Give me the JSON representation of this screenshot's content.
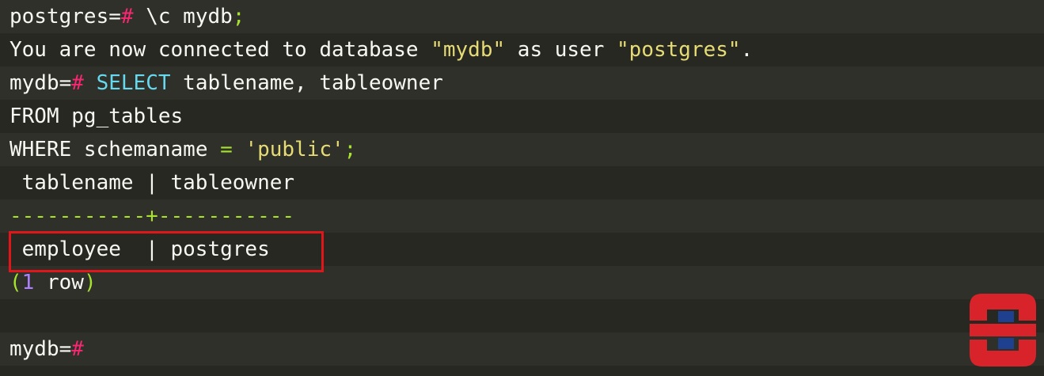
{
  "terminal": {
    "line1": {
      "prompt": "postgres=",
      "hash": "#",
      "cmd": " \\c mydb",
      "semi": ";"
    },
    "line2": {
      "prefix": "You are now connected to database ",
      "db": "\"mydb\"",
      "mid": " as user ",
      "user": "\"postgres\"",
      "end": "."
    },
    "line3": {
      "prompt": "mydb=",
      "hash": "#",
      "kw": " SELECT",
      "rest": " tablename, tableowner"
    },
    "line4": {
      "text": "FROM pg_tables"
    },
    "line5": {
      "kw": "WHERE",
      "col": " schemaname ",
      "op": "=",
      "sp": " ",
      "str": "'public'",
      "semi": ";"
    },
    "line6": {
      "text": " tablename | tableowner"
    },
    "line7": {
      "text": "-----------+-----------"
    },
    "line8": {
      "text": " employee  | postgres"
    },
    "line9": {
      "open": "(",
      "num": "1",
      "text": " row",
      "close": ")"
    },
    "line11": {
      "prompt": "mydb=",
      "hash": "#"
    }
  },
  "colors": {
    "background": "#272822",
    "text": "#f8f8f2",
    "keyword": "#66d9ef",
    "string": "#e6db74",
    "hash": "#f92672",
    "accent_green": "#a6e22e",
    "number": "#ae81ff",
    "highlight_border": "#e0161b",
    "logo_red": "#d9232a",
    "logo_blue": "#1f3f8f"
  },
  "logo": {
    "icon": "sb-logo-icon"
  }
}
